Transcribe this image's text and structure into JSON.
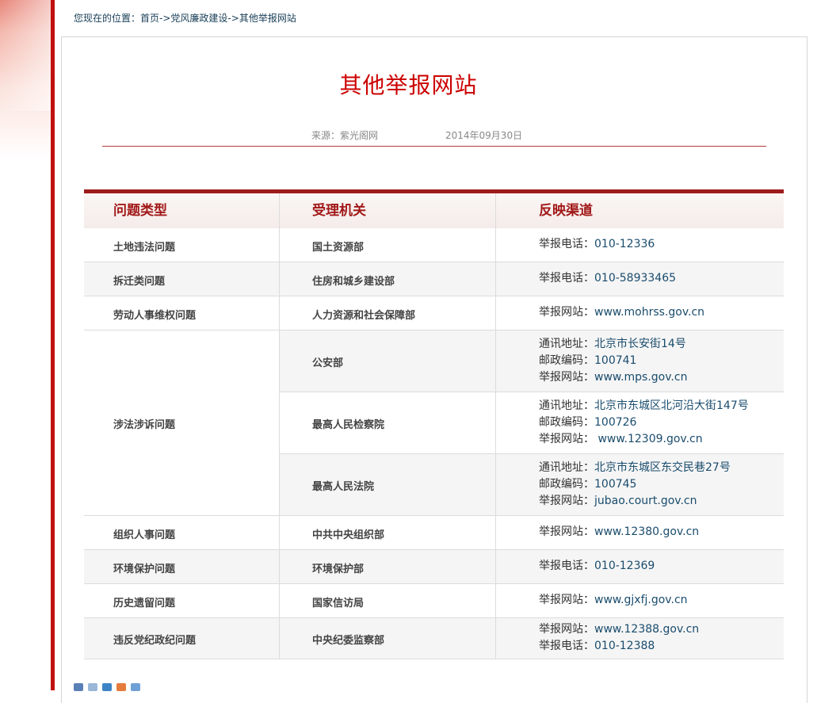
{
  "breadcrumb": {
    "prefix": "您现在的位置：",
    "items": [
      "首页",
      "->",
      "党风廉政建设",
      "->",
      "其他举报网站"
    ]
  },
  "article": {
    "title": "其他举报网站",
    "source": "来源：紫光阁网",
    "date": "2014年09月30日"
  },
  "table": {
    "headers": [
      "问题类型",
      "受理机关",
      "反映渠道"
    ],
    "rows": [
      {
        "type": "土地违法问题",
        "agency": "国土资源部",
        "lines": [
          {
            "label": "举报电话：",
            "value": "010-12336"
          }
        ]
      },
      {
        "type": "拆迁类问题",
        "agency": "住房和城乡建设部",
        "lines": [
          {
            "label": "举报电话：",
            "value": "010-58933465"
          }
        ]
      },
      {
        "type": "劳动人事维权问题",
        "agency": "人力资源和社会保障部",
        "lines": [
          {
            "label": "举报网站：",
            "value": "www.mohrss.gov.cn"
          }
        ]
      },
      {
        "type": "涉法涉诉问题",
        "agency": "公安部",
        "lines": [
          {
            "label": "通讯地址：",
            "value": "北京市长安街14号"
          },
          {
            "label": "邮政编码：",
            "value": "100741"
          },
          {
            "label": "举报网站：",
            "value": "www.mps.gov.cn"
          }
        ]
      },
      {
        "type": "",
        "agency": "最高人民检察院",
        "lines": [
          {
            "label": "通讯地址：",
            "value": "北京市东城区北河沿大街147号"
          },
          {
            "label": "邮政编码：",
            "value": "100726"
          },
          {
            "label": "举报网站：",
            "value": " www.12309.gov.cn"
          }
        ]
      },
      {
        "type": "",
        "agency": "最高人民法院",
        "lines": [
          {
            "label": "通讯地址：",
            "value": "北京市东城区东交民巷27号"
          },
          {
            "label": "邮政编码：",
            "value": "100745"
          },
          {
            "label": "举报网站：",
            "value": "jubao.court.gov.cn"
          }
        ]
      },
      {
        "type": "组织人事问题",
        "agency": "中共中央组织部",
        "lines": [
          {
            "label": "举报网站：",
            "value": "www.12380.gov.cn"
          }
        ]
      },
      {
        "type": "环境保护问题",
        "agency": "环境保护部",
        "lines": [
          {
            "label": "举报电话：",
            "value": "010-12369"
          }
        ]
      },
      {
        "type": "历史遗留问题",
        "agency": "国家信访局",
        "lines": [
          {
            "label": "举报网站：",
            "value": "www.gjxfj.gov.cn"
          }
        ]
      },
      {
        "type": "违反党纪政纪问题",
        "agency": "中央纪委监察部",
        "lines": [
          {
            "label": "举报网站：",
            "value": "www.12388.gov.cn"
          },
          {
            "label": "举报电话：",
            "value": "010-12388"
          }
        ]
      }
    ]
  },
  "colors": {
    "accent": "#cc0000",
    "header_text": "#a11818",
    "border": "#9e1b1b",
    "link": "#1a4c6d"
  },
  "share_icons": [
    "share-icon-1",
    "share-icon-2",
    "share-icon-3",
    "share-icon-4",
    "share-icon-5"
  ]
}
